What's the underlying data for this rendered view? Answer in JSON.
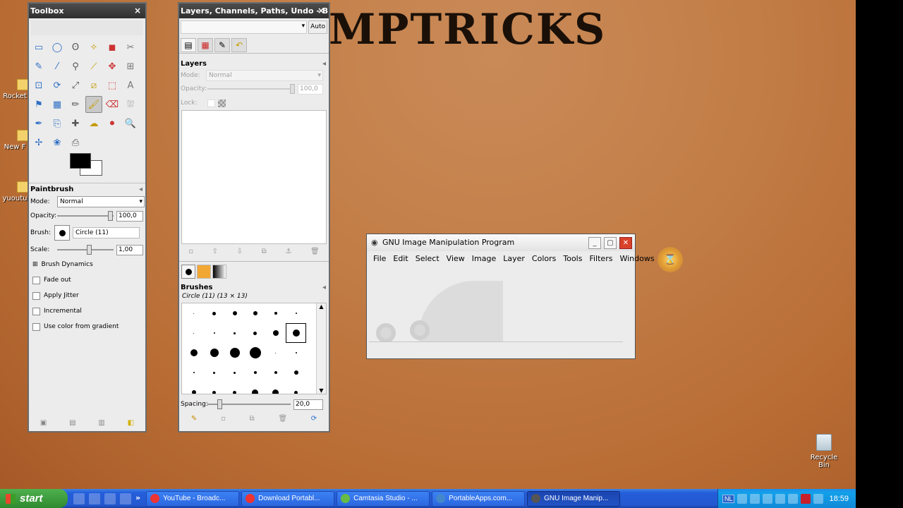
{
  "desktop": {
    "banner": "MPTRICKS",
    "icons": [
      "Rocket",
      "New F",
      "yuoutu"
    ],
    "recycle_bin": "Recycle Bin"
  },
  "toolbox": {
    "title": "Toolbox",
    "close": "×",
    "tool_icons": [
      "rect-select-icon",
      "ellipse-select-icon",
      "lasso-icon",
      "fuzzy-select-icon",
      "color-select-icon",
      "scissors-icon",
      "paths-icon",
      "color-picker-icon",
      "zoom-icon",
      "measure-icon",
      "move-icon",
      "align-icon",
      "crop-icon",
      "rotate-icon",
      "scale-icon",
      "shear-icon",
      "perspective-icon",
      "text-icon",
      "bucket-fill-icon",
      "blend-icon",
      "pencil-icon",
      "paintbrush-icon",
      "eraser-icon",
      "airbrush-icon",
      "ink-icon",
      "clone-icon",
      "heal-icon",
      "smudge-icon",
      "dodge-icon",
      "magnify-icon",
      "flip-icon",
      "cage-icon",
      "warp-icon"
    ],
    "tool_glyphs": [
      "▭",
      "◯",
      "ʘ",
      "✧",
      "◼",
      "✂",
      "✎",
      "⁄",
      "⚲",
      "⟋",
      "✥",
      "⊞",
      "⊡",
      "⟳",
      "⤢",
      "⧄",
      "⬚",
      "A",
      "⚑",
      "▦",
      "✏",
      "🖌",
      "⌫",
      "⛆",
      "✒",
      "⎘",
      "✚",
      "☁",
      "⚫",
      "🔍",
      "✢",
      "❀",
      "⎙"
    ],
    "selected_tool_index": 21,
    "paintbrush": {
      "title": "Paintbrush",
      "mode_label": "Mode:",
      "mode_value": "Normal",
      "opacity_label": "Opacity:",
      "opacity_value": "100,0",
      "brush_label": "Brush:",
      "brush_value": "Circle (11)",
      "scale_label": "Scale:",
      "scale_value": "1,00",
      "brush_dynamics": "Brush Dynamics",
      "fade_out": "Fade out",
      "apply_jitter": "Apply Jitter",
      "incremental": "Incremental",
      "use_color_gradient": "Use color from gradient"
    }
  },
  "layers_dock": {
    "title": "Layers, Channels, Paths, Undo - Bru...",
    "auto_button": "Auto",
    "layers_title": "Layers",
    "mode_label": "Mode:",
    "mode_value": "Normal",
    "opacity_label": "Opacity:",
    "opacity_value": "100,0",
    "lock_label": "Lock:",
    "brushes_title": "Brushes",
    "brush_info": "Circle (11) (13 × 13)",
    "spacing_label": "Spacing:",
    "spacing_value": "20,0"
  },
  "gimp_window": {
    "title": "GNU Image Manipulation Program",
    "menu": [
      "File",
      "Edit",
      "Select",
      "View",
      "Image",
      "Layer",
      "Colors",
      "Tools",
      "Filters",
      "Windows"
    ]
  },
  "taskbar": {
    "start": "start",
    "tasks": [
      "YouTube - Broadc...",
      "Download Portabl...",
      "Camtasia Studio - ...",
      "PortableApps.com...",
      "GNU Image Manip..."
    ],
    "active_task_index": 4,
    "language": "NL",
    "clock": "18:59"
  }
}
